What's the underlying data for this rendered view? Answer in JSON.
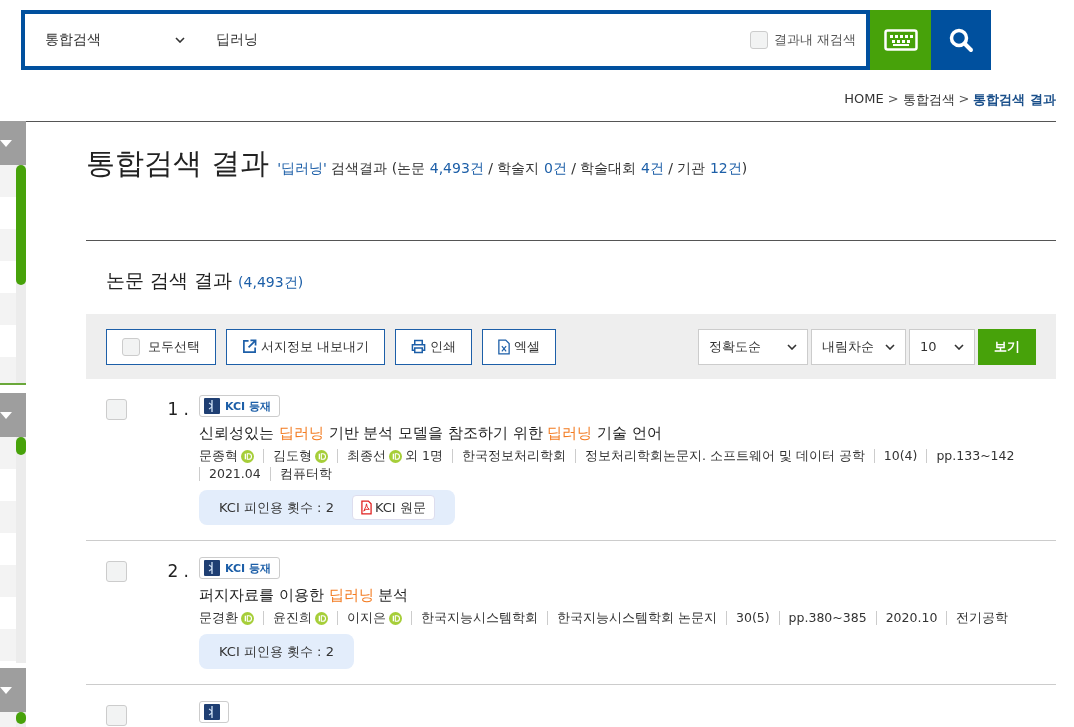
{
  "search": {
    "scope": "통합검색",
    "query": "딥러닝",
    "refine": {
      "label": "결과내 재검색",
      "checked": false
    }
  },
  "breadcrumb": [
    {
      "text": "HOME",
      "kind": "link"
    },
    {
      "text": ">",
      "kind": "sep"
    },
    {
      "text": "통합검색",
      "kind": "link"
    },
    {
      "text": ">",
      "kind": "sep"
    },
    {
      "text": "통합검색 결과",
      "kind": "current"
    }
  ],
  "heading": {
    "title": "통합검색 결과",
    "summary": [
      {
        "text": "'딥러닝'",
        "highlight": true
      },
      {
        "text": " 검색결과 (논문 ",
        "highlight": false
      },
      {
        "text": "4,493건",
        "highlight": true
      },
      {
        "text": " / 학술지 ",
        "highlight": false
      },
      {
        "text": "0건",
        "highlight": true
      },
      {
        "text": " / 학술대회 ",
        "highlight": false
      },
      {
        "text": "4건",
        "highlight": true
      },
      {
        "text": " / 기관 ",
        "highlight": false
      },
      {
        "text": "12건",
        "highlight": true
      },
      {
        "text": ")",
        "highlight": false
      }
    ]
  },
  "section": {
    "title": "논문 검색 결과",
    "count": "(4,493건)"
  },
  "toolbar": {
    "select_all": {
      "label": "모두선택",
      "checked": false
    },
    "actions": [
      {
        "label": "서지정보 내보내기",
        "kind": "export"
      },
      {
        "label": "인쇄",
        "kind": "print"
      },
      {
        "label": "엑셀",
        "kind": "excel"
      }
    ],
    "sorts": [
      "정확도순",
      "내림차순",
      "10"
    ],
    "submit": "보기"
  },
  "results": [
    {
      "checked": false,
      "number": "1 .",
      "badge": {
        "kind": "kci",
        "label": "KCI 등재"
      },
      "title": [
        {
          "text": "신뢰성있는 ",
          "highlight": false
        },
        {
          "text": "딥러닝",
          "highlight": true
        },
        {
          "text": " 기반 분석 모델을 참조하기 위한 ",
          "highlight": false
        },
        {
          "text": "딥러닝",
          "highlight": true
        },
        {
          "text": " 기술 언어",
          "highlight": false
        }
      ],
      "meta": [
        {
          "text": "문종혁",
          "kind": "author"
        },
        {
          "text": "김도형",
          "kind": "author"
        },
        {
          "text": "최종선",
          "kind": "author",
          "extra": "외 1명"
        },
        {
          "text": "한국정보처리학회",
          "kind": "plain"
        },
        {
          "text": "정보처리학회논문지. 소프트웨어 및 데이터 공학",
          "kind": "plain"
        },
        {
          "text": "10(4)",
          "kind": "plain"
        },
        {
          "text": "pp.133~142",
          "kind": "plain"
        },
        {
          "text": "2021.04",
          "kind": "plain"
        },
        {
          "text": "컴퓨터학",
          "kind": "plain"
        }
      ],
      "citation": "KCI 피인용 횟수 : 2",
      "fulltext": "KCI 원문"
    },
    {
      "checked": false,
      "number": "2 .",
      "badge": {
        "kind": "kci",
        "label": "KCI 등재"
      },
      "title": [
        {
          "text": "퍼지자료를 이용한 ",
          "highlight": false
        },
        {
          "text": "딥러닝",
          "highlight": true
        },
        {
          "text": " 분석",
          "highlight": false
        }
      ],
      "meta": [
        {
          "text": "문경환",
          "kind": "author"
        },
        {
          "text": "윤진희",
          "kind": "author"
        },
        {
          "text": "이지은",
          "kind": "author"
        },
        {
          "text": "한국지능시스템학회",
          "kind": "plain"
        },
        {
          "text": "한국지능시스템학회 논문지",
          "kind": "plain"
        },
        {
          "text": "30(5)",
          "kind": "plain"
        },
        {
          "text": "pp.380~385",
          "kind": "plain"
        },
        {
          "text": "2020.10",
          "kind": "plain"
        },
        {
          "text": "전기공학",
          "kind": "plain"
        }
      ],
      "citation": "KCI 피인용 횟수 : 2"
    },
    {
      "checked": false,
      "badge": {
        "kind": "kci"
      }
    }
  ]
}
